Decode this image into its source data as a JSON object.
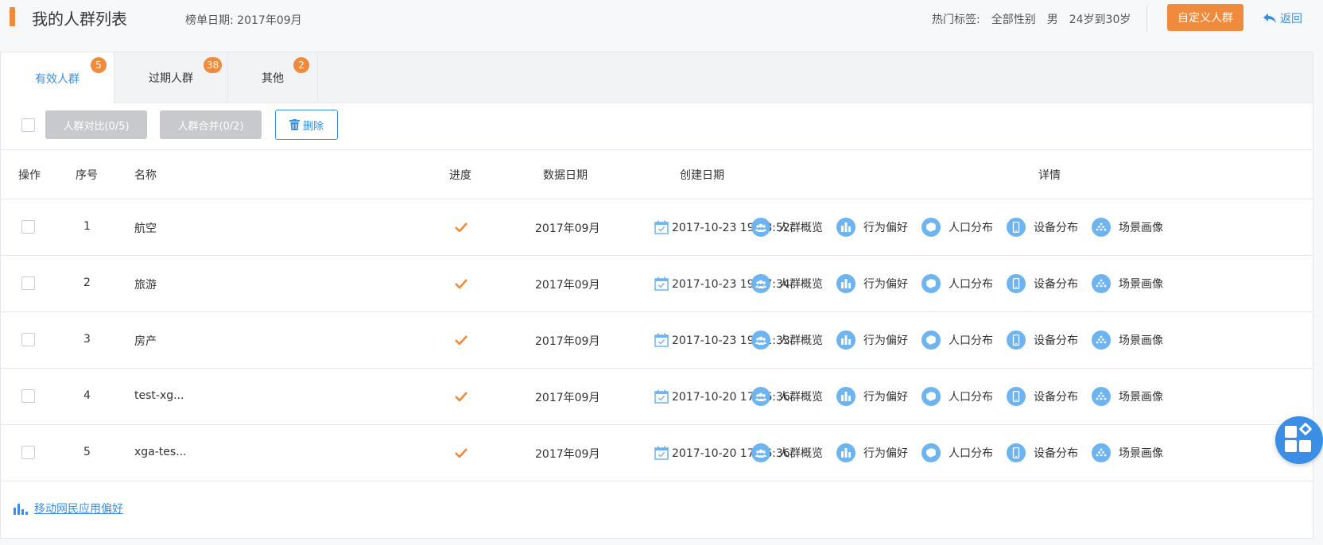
{
  "header": {
    "title": "我的人群列表",
    "report_date": "榜单日期: 2017年09月",
    "hot_tags_title": "热门标签:",
    "hot_tags": [
      "全部性别",
      "男",
      "24岁到30岁"
    ],
    "custom_button": "自定义人群",
    "back_label": "返回"
  },
  "tabs": [
    {
      "label": "有效人群",
      "badge": "5"
    },
    {
      "label": "过期人群",
      "badge": "38"
    },
    {
      "label": "其他",
      "badge": "2"
    }
  ],
  "toolbar": {
    "compare_label": "人群对比(0/5)",
    "merge_label": "人群合并(0/2)",
    "delete_label": "删除"
  },
  "table": {
    "columns": [
      "操作",
      "序号",
      "名称",
      "进度",
      "数据日期",
      "创建日期",
      "详情"
    ],
    "detail_links": [
      "人群概览",
      "行为偏好",
      "人口分布",
      "设备分布",
      "场景画像"
    ],
    "rows": [
      {
        "index": "1",
        "name": "航空",
        "data_date": "2017年09月",
        "created": "2017-10-23 19:28:52"
      },
      {
        "index": "2",
        "name": "旅游",
        "data_date": "2017年09月",
        "created": "2017-10-23 19:27:34"
      },
      {
        "index": "3",
        "name": "房产",
        "data_date": "2017年09月",
        "created": "2017-10-23 19:11:33"
      },
      {
        "index": "4",
        "name": "test-xg...",
        "data_date": "2017年09月",
        "created": "2017-10-20 17:56:36"
      },
      {
        "index": "5",
        "name": "xga-tes...",
        "data_date": "2017年09月",
        "created": "2017-10-20 17:56:36"
      }
    ]
  },
  "footer": {
    "link_label": "移动网民应用偏好"
  },
  "colors": {
    "accent": "#f08a3c",
    "primary": "#3a8ee6",
    "icon_blue": "#6db4f0",
    "disabled": "#c8c9cc"
  },
  "icons": {
    "back": "back-arrow-icon",
    "delete": "trash-icon",
    "progress": "checkmark-icon",
    "created": "calendar-icon",
    "footer": "bar-chart-icon",
    "float": "apps-grid-icon"
  }
}
